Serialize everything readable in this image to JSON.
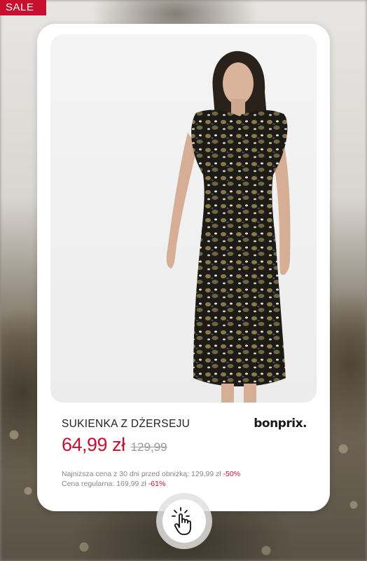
{
  "badge": {
    "label": "SALE"
  },
  "product": {
    "title": "SUKIENKA Z DŻERSEJU",
    "brand": "bonprix.",
    "price_current": "64,99 zł",
    "price_old": "129,99",
    "lowest_price_text": "Najniższa cena z 30 dni przed obniżką: 129,99 zł",
    "lowest_price_discount": "-50%",
    "regular_price_text": "Cena regularna: 169,99 zł",
    "regular_price_discount": "-61%",
    "image_subject": "model-wearing-leopard-print-dress"
  },
  "cta": {
    "icon": "tap-hand-icon"
  },
  "colors": {
    "accent": "#c8102e",
    "card": "#ffffff",
    "text": "#222222",
    "muted": "#888888"
  }
}
